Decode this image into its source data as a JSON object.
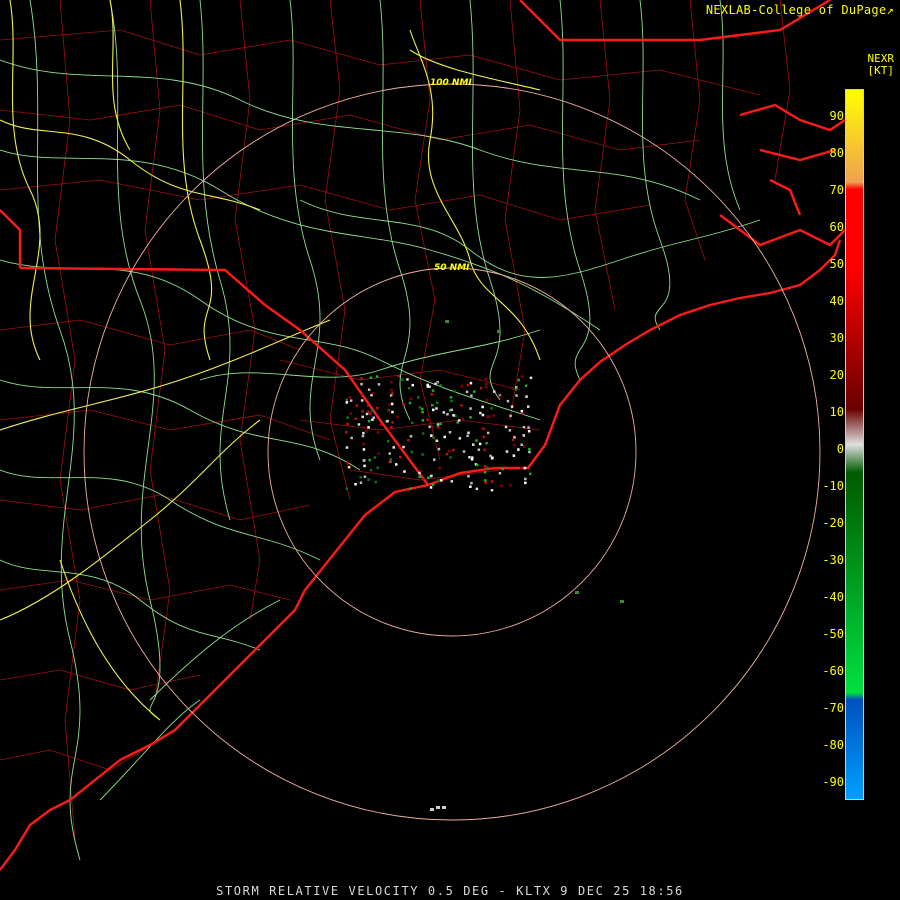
{
  "header": {
    "credit": "NEXLAB-College of DuPage",
    "credit_mark": "↗"
  },
  "legend": {
    "product": "NEXR",
    "units": "[KT]",
    "ticks": [
      "90",
      "80",
      "70",
      "60",
      "50",
      "40",
      "30",
      "20",
      "10",
      "0",
      "-10",
      "-20",
      "-30",
      "-40",
      "-50",
      "-60",
      "-70",
      "-80",
      "-90"
    ],
    "colors": {
      "high": "#ffff00",
      "orange": "#f0a050",
      "red": "#ff0000",
      "dark_red": "#6a0000",
      "zero_white": "#e0e0e0",
      "dark_green": "#005a00",
      "green": "#00e040",
      "blue": "#0050c0",
      "light_blue": "#00a0ff"
    }
  },
  "map": {
    "ring_labels": [
      "100 NMI",
      "50 NMI"
    ],
    "colors": {
      "state_borders": "#ff2020",
      "county_lines": "#b01010",
      "highways": "#90e890",
      "interstates": "#f0f060",
      "range_rings": "#f0b0a0"
    }
  },
  "footer": {
    "caption": "STORM RELATIVE VELOCITY 0.5 DEG - KLTX 9 DEC 25 18:56"
  }
}
